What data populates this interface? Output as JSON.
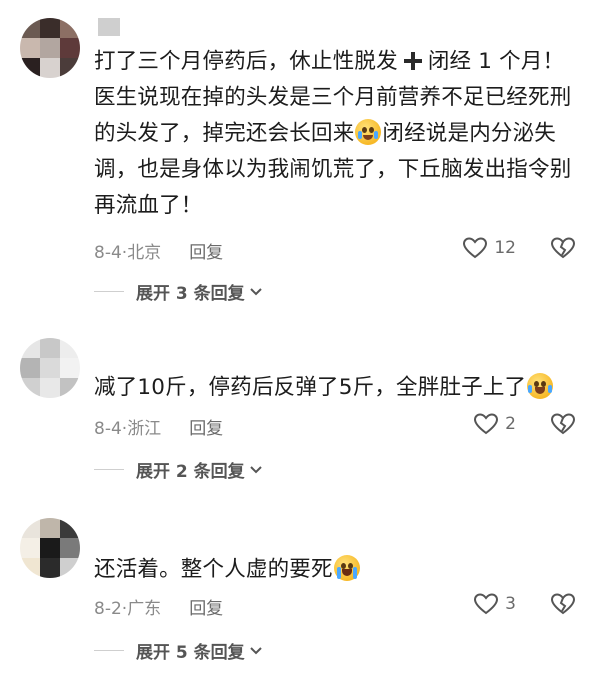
{
  "comments": [
    {
      "text_parts": [
        "打了三个月停药后，休止性脱发",
        "闭经 1 个月！医生说现在掉的头发是三个月前营养不足已经死刑的头发了，掉完还会长回来",
        "闭经说是内分泌失调，也是身体以为我闹饥荒了，下丘脑发出指令别再流血了！"
      ],
      "date": "8-4",
      "location": "北京",
      "reply_label": "回复",
      "likes": "12",
      "expand_label": "展开 3 条回复"
    },
    {
      "text_parts": [
        "减了10斤，停药后反弹了5斤，全胖肚子上了"
      ],
      "date": "8-4",
      "location": "浙江",
      "reply_label": "回复",
      "likes": "2",
      "expand_label": "展开 2 条回复"
    },
    {
      "text_parts": [
        "还活着。整个人虚的要死"
      ],
      "date": "8-2",
      "location": "广东",
      "reply_label": "回复",
      "likes": "3",
      "expand_label": "展开 5 条回复"
    }
  ],
  "meta_separator": "·",
  "icons": {
    "like": "heart-outline-icon",
    "dislike": "broken-heart-icon",
    "expand": "chevron-down-icon",
    "plus": "plus-icon",
    "emoji_1": "crying-face-emoji",
    "emoji_2": "laughing-tears-face-emoji",
    "emoji_3": "sobbing-face-emoji"
  },
  "colors": {
    "text": "#1c1c1c",
    "meta": "#8a8a8a",
    "avatar_blur": "#9a9a9a"
  }
}
